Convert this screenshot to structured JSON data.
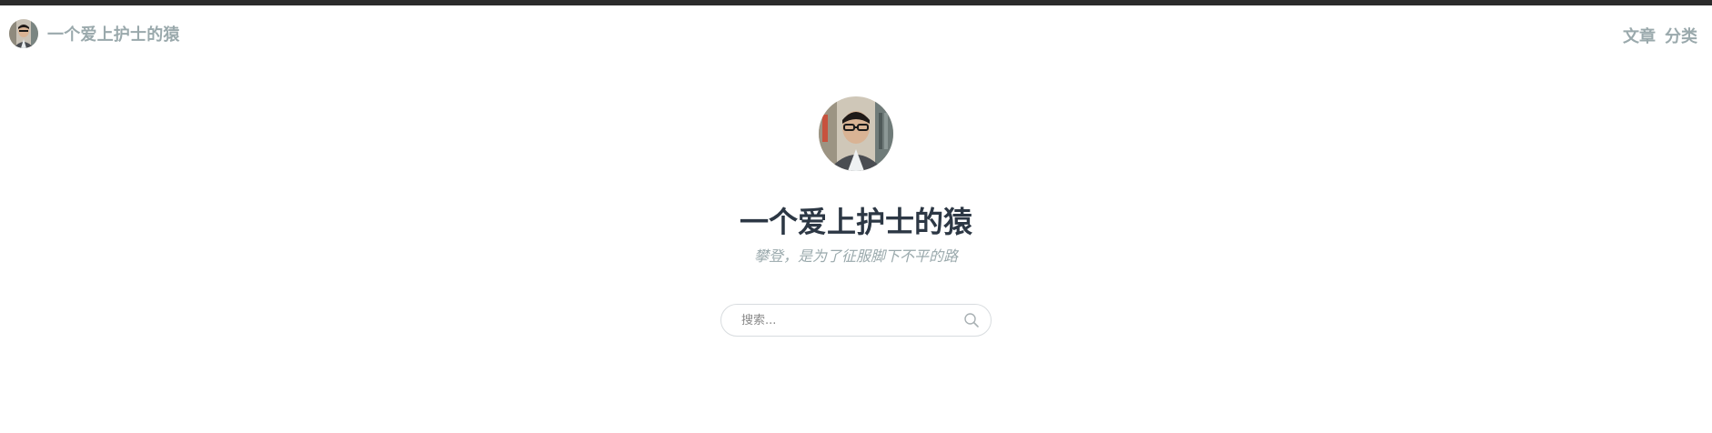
{
  "header": {
    "brand_name": "一个爱上护士的猿",
    "nav": [
      {
        "label": "文章"
      },
      {
        "label": "分类"
      }
    ]
  },
  "hero": {
    "title": "一个爱上护士的猿",
    "subtitle": "攀登，是为了征服脚下不平的路"
  },
  "search": {
    "placeholder": "搜索...",
    "value": ""
  },
  "colors": {
    "topbar": "#2b2b2b",
    "muted_text": "#9aa9ac",
    "title_text": "#2c3744",
    "search_border": "#d8dcdf"
  },
  "icons": {
    "search": "search-icon",
    "avatar": "avatar"
  }
}
